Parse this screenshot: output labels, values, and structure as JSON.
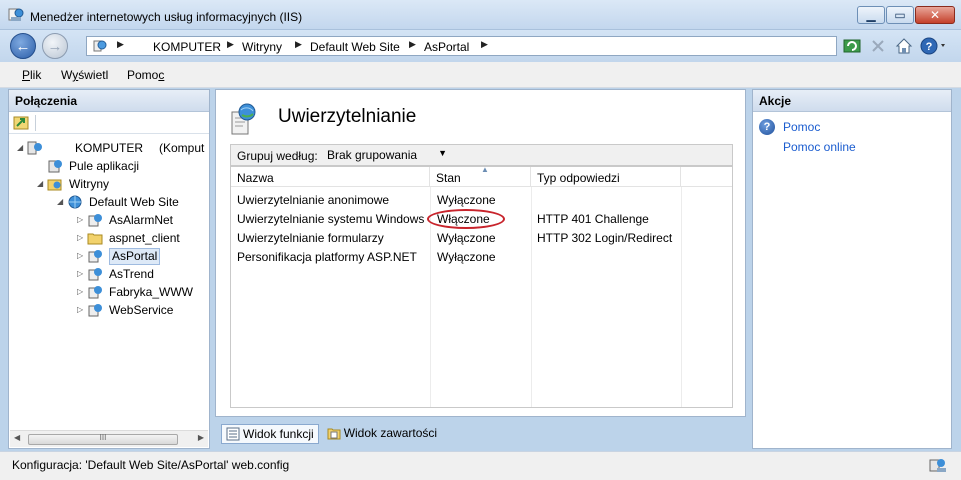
{
  "window": {
    "title": "Menedżer internetowych usług informacyjnych (IIS)"
  },
  "address": {
    "crumbs": [
      "KOMPUTER",
      "Witryny",
      "Default Web Site",
      "AsPortal"
    ]
  },
  "menu": {
    "file": "Plik",
    "view": "Wyświetl",
    "help": "Pomoc"
  },
  "connections": {
    "title": "Połączenia",
    "tree": [
      {
        "label": "KOMPUTER",
        "suffix": "(Komput",
        "level": 0
      },
      {
        "label": "Pule aplikacji",
        "level": 1
      },
      {
        "label": "Witryny",
        "level": 1
      },
      {
        "label": "Default Web Site",
        "level": 2
      },
      {
        "label": "AsAlarmNet",
        "level": 3
      },
      {
        "label": "aspnet_client",
        "level": 3
      },
      {
        "label": "AsPortal",
        "level": 3,
        "selected": true
      },
      {
        "label": "AsTrend",
        "level": 3
      },
      {
        "label": "Fabryka_WWW",
        "level": 3
      },
      {
        "label": "WebService",
        "level": 3
      }
    ],
    "scroll_label": "III"
  },
  "main": {
    "title": "Uwierzytelnianie",
    "group_label": "Grupuj według:",
    "group_value": "Brak grupowania",
    "columns": [
      "Nazwa",
      "Stan",
      "Typ odpowiedzi"
    ],
    "rows": [
      {
        "name": "Uwierzytelnianie anonimowe",
        "state": "Wyłączone",
        "type": ""
      },
      {
        "name": "Uwierzytelnianie systemu Windows",
        "state": "Włączone",
        "type": "HTTP 401 Challenge"
      },
      {
        "name": "Uwierzytelnianie formularzy",
        "state": "Wyłączone",
        "type": "HTTP 302 Login/Redirect"
      },
      {
        "name": "Personifikacja platformy ASP.NET",
        "state": "Wyłączone",
        "type": ""
      }
    ],
    "view_features": "Widok funkcji",
    "view_content": "Widok zawartości"
  },
  "actions": {
    "title": "Akcje",
    "help": "Pomoc",
    "help_online": "Pomoc online"
  },
  "status": {
    "text": "Konfiguracja: 'Default Web Site/AsPortal' web.config"
  },
  "colors": {
    "link": "#1a5ccf",
    "highlight_oval": "#c8242c",
    "chrome": "#c3d7ee"
  }
}
